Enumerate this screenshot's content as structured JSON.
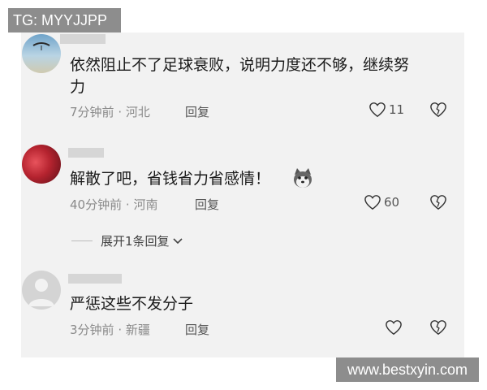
{
  "watermarks": {
    "top_left": "TG: MYYJJPP",
    "bottom_right": "www.bestxyin.com"
  },
  "comments": [
    {
      "text_line1": "依然阻止不了足球衰败，说明力度还不够，继续努",
      "text_line2": "力",
      "time": "7分钟前",
      "separator": "·",
      "location": "河北",
      "reply_label": "回复",
      "likes": "11"
    },
    {
      "text": "解散了吧，省钱省力省感情！",
      "emoji_icon": "husky-emoji-icon",
      "time": "40分钟前",
      "separator": "·",
      "location": "河南",
      "reply_label": "回复",
      "likes": "60",
      "expand_label": "展开1条回复"
    },
    {
      "text": "严惩这些不发分子",
      "time": "3分钟前",
      "separator": "·",
      "location": "新疆",
      "reply_label": "回复",
      "likes": ""
    }
  ],
  "colors": {
    "panel": "#f2f2f2",
    "meta": "#8a8a8a",
    "watermark_bg": "#8d8d8d"
  }
}
